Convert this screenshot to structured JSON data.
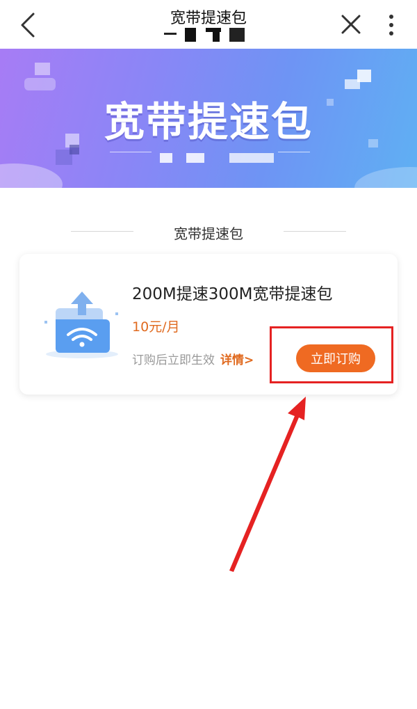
{
  "nav": {
    "title": "宽带提速包",
    "icons": {
      "back": "chevron-left-icon",
      "close": "close-icon",
      "more": "more-vertical-icon"
    }
  },
  "banner": {
    "title": "宽带提速包",
    "colors": {
      "from": "#a77cf5",
      "to": "#5fb0f3"
    }
  },
  "section": {
    "title": "宽带提速包"
  },
  "product": {
    "name": "200M提速300M宽带提速包",
    "price": "10元/月",
    "description": "订购后立即生效",
    "details_label": "详情>",
    "subscribe_label": "立即订购",
    "icon": "wifi-folder-icon"
  },
  "colors": {
    "accent": "#ef6a22",
    "annotation": "#e52222"
  }
}
